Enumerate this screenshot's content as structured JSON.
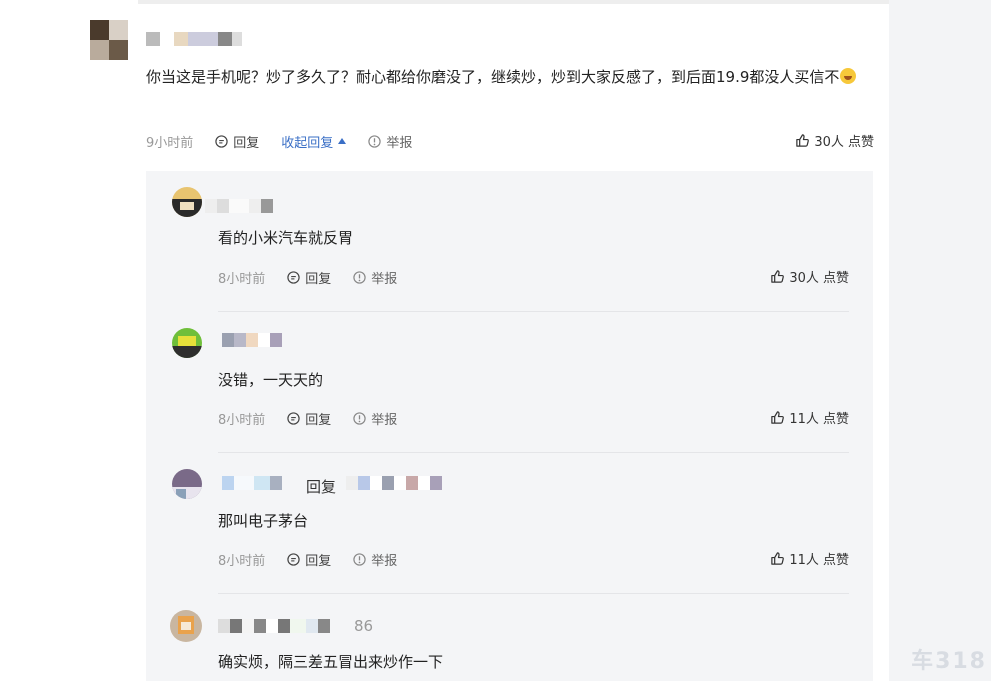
{
  "comment": {
    "text": "你当这是手机呢？炒了多久了？耐心都给你磨没了，继续炒，炒到大家反感了，到后面19.9都没人买信不",
    "time": "9小时前",
    "reply_label": "回复",
    "collapse_label": "收起回复",
    "report_label": "举报",
    "like_label": "30人 点赞"
  },
  "replies": [
    {
      "text": "看的小米汽车就反胃",
      "time": "8小时前",
      "reply_label": "回复",
      "report_label": "举报",
      "like_label": "30人 点赞"
    },
    {
      "text": "没错，一天天的",
      "time": "8小时前",
      "reply_label": "回复",
      "report_label": "举报",
      "like_label": "11人 点赞"
    },
    {
      "reply_to_label": "回复",
      "text": "那叫电子茅台",
      "time": "8小时前",
      "reply_label": "回复",
      "report_label": "举报",
      "like_label": "11人 点赞"
    },
    {
      "name_suffix": "86",
      "text": "确实烦，隔三差五冒出来炒作一下"
    }
  ],
  "watermark": "车318",
  "colors": {
    "accent": "#3a6fc6",
    "reply_bg": "#f4f5f7",
    "muted": "#999999"
  }
}
